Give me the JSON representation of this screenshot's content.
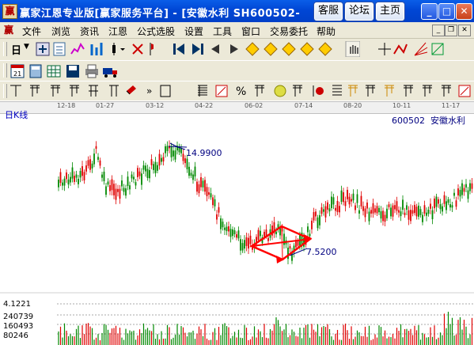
{
  "title_bar": {
    "icon": "赢",
    "title": "赢家江恩专业版[赢家服务平台] - [安徽水利   SH600502-",
    "buttons": [
      "客服",
      "论坛",
      "主页"
    ]
  },
  "menu": {
    "icon": "赢",
    "items": [
      "文件",
      "浏览",
      "资讯",
      "江恩",
      "公式选股",
      "设置",
      "工具",
      "窗口",
      "交易委托",
      "帮助"
    ]
  },
  "toolbar": {
    "period_dropdown": "日"
  },
  "timeline": {
    "labels": [
      "12-18",
      "01-27",
      "03-12",
      "04-22",
      "06-02",
      "07-14",
      "08-20",
      "10-11",
      "11-17"
    ]
  },
  "chart": {
    "period_label": "日K线",
    "stock_code": "600502",
    "stock_name": "安徽水利",
    "high_marker": "14.9900",
    "low_marker": "7.5200",
    "volume_labels": [
      "4.1221",
      "240739",
      "160493",
      "80246"
    ],
    "colors": {
      "up": "#e00000",
      "down": "#008800",
      "annotation": "#000080",
      "pattern": "#ff0000"
    }
  }
}
